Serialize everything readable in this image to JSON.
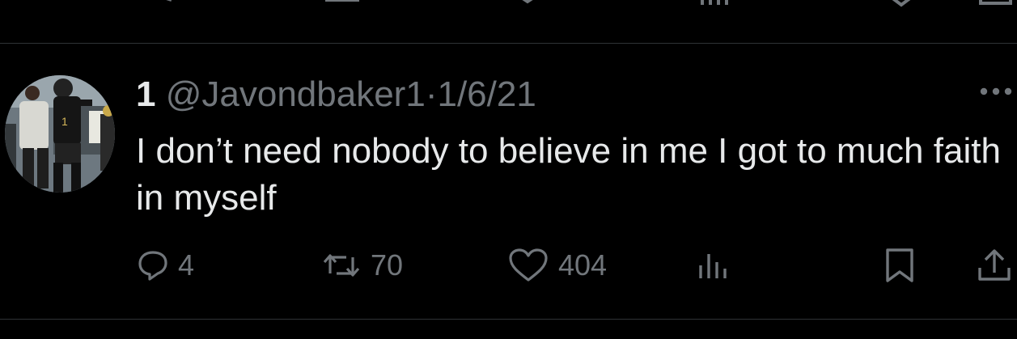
{
  "tweet": {
    "display_name": "1",
    "handle": "@Javondbaker1",
    "separator": "·",
    "date": "1/6/21",
    "text": "I don’t need nobody to believe in me I got to much faith in myself",
    "more_icon": "more-horizontal-icon",
    "avatar_icon": "profile-photo",
    "actions": {
      "reply": {
        "icon": "reply-icon",
        "count": "4"
      },
      "retweet": {
        "icon": "retweet-icon",
        "count": "70"
      },
      "like": {
        "icon": "heart-icon",
        "count": "404"
      },
      "views": {
        "icon": "analytics-icon"
      },
      "bookmark": {
        "icon": "bookmark-icon"
      },
      "share": {
        "icon": "share-icon"
      }
    }
  },
  "colors": {
    "background": "#000000",
    "text": "#e7e9ea",
    "muted": "#71767b",
    "divider": "#2f3336"
  }
}
